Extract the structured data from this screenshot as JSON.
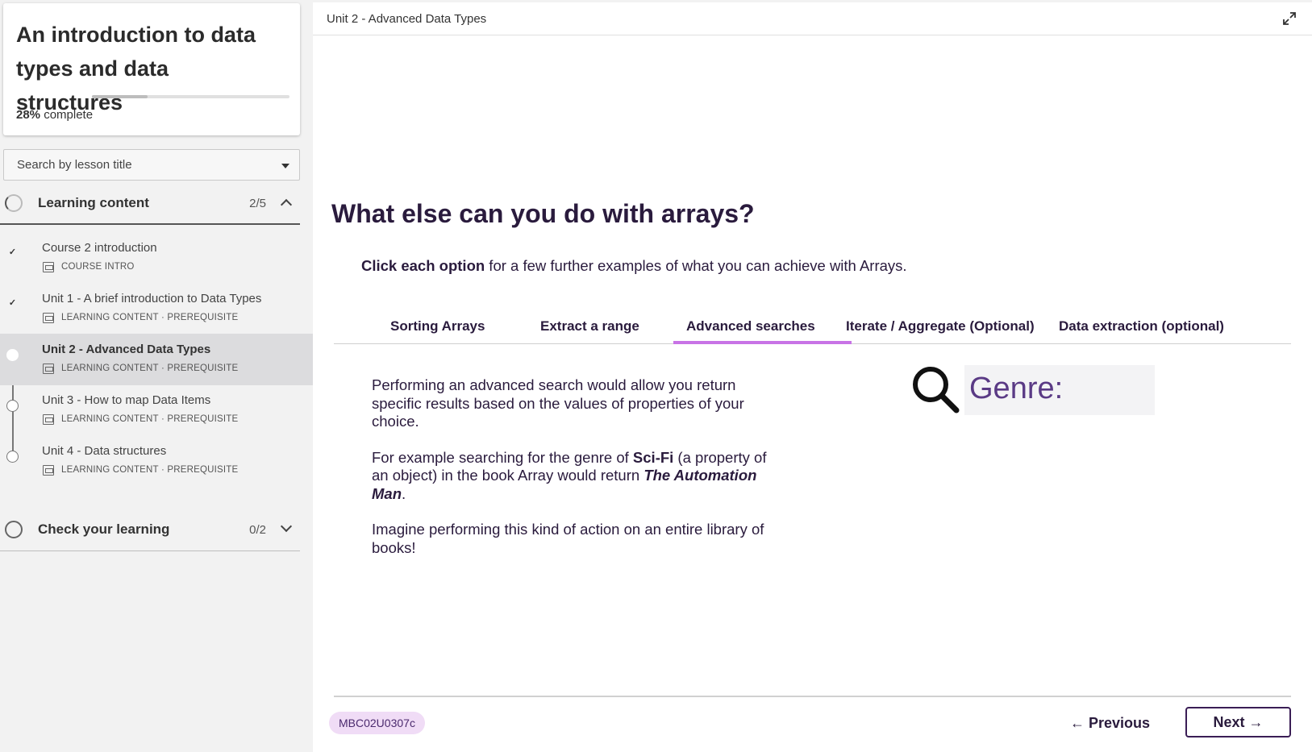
{
  "course": {
    "title": "An introduction to data types and data structures",
    "progress_percent": 28,
    "progress_value": "28%",
    "progress_suffix": " complete"
  },
  "lesson_search": {
    "placeholder": "Search by lesson title"
  },
  "sections": [
    {
      "title": "Learning content",
      "count": "2/5",
      "expanded": true
    },
    {
      "title": "Check your learning",
      "count": "0/2",
      "expanded": false
    }
  ],
  "lessons": [
    {
      "title": "Course 2 introduction",
      "meta": "COURSE INTRO",
      "status": "done",
      "check": "✓"
    },
    {
      "title": "Unit 1 - A brief introduction to Data Types",
      "meta": "LEARNING CONTENT · PREREQUISITE",
      "status": "done",
      "check": "✓"
    },
    {
      "title": "Unit 2 - Advanced Data Types",
      "meta": "LEARNING CONTENT · PREREQUISITE",
      "status": "current"
    },
    {
      "title": "Unit 3 - How to map Data Items",
      "meta": "LEARNING CONTENT · PREREQUISITE",
      "status": "todo"
    },
    {
      "title": "Unit 4 - Data structures",
      "meta": "LEARNING CONTENT · PREREQUISITE",
      "status": "todo"
    }
  ],
  "topbar": {
    "title": "Unit 2 - Advanced Data Types"
  },
  "content": {
    "title": "What else can you do with arrays?",
    "intro_bold": "Click each option",
    "intro_rest": " for a few further examples of what you can achieve with Arrays.",
    "tabs": [
      {
        "label": "Sorting Arrays",
        "active": false
      },
      {
        "label": "Extract a range",
        "active": false
      },
      {
        "label": "Advanced searches",
        "active": true
      },
      {
        "label": "Iterate / Aggregate (Optional)",
        "active": false
      },
      {
        "label": "Data extraction (optional)",
        "active": false
      }
    ],
    "paragraph1": "Performing an advanced search would allow you return specific results based on the values of properties of your choice.",
    "paragraph2_a": "For example searching for the genre of ",
    "paragraph2_bold": "Sci-Fi",
    "paragraph2_b": " (a property of an object) in the book Array would return ",
    "paragraph2_italic": "The Automation Man",
    "paragraph2_c": ".",
    "paragraph3": "Imagine performing this kind of action on an entire library of books!",
    "graphic_label": "Genre:"
  },
  "footer": {
    "code": "MBC02U0307c",
    "previous_label": "← Previous",
    "next_label": "Next →"
  },
  "colors": {
    "accent": "#c873e6",
    "heading": "#2a1b3d",
    "badge_bg": "#f0dcf6"
  }
}
